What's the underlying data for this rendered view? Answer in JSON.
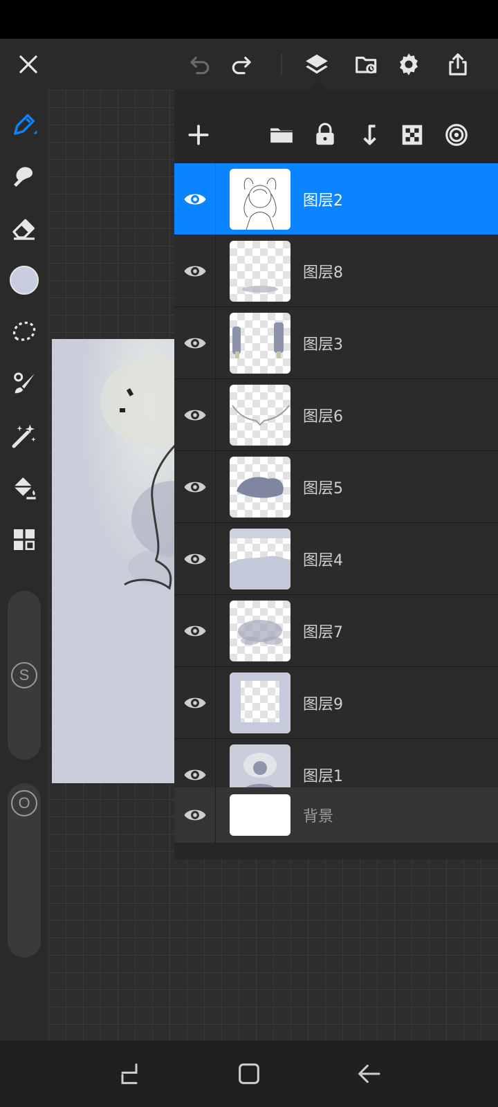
{
  "colors": {
    "accent": "#0a84ff",
    "brush_color": "#c8cee0",
    "toolbar_bg": "#2a2a2a",
    "panel_bg": "#262626",
    "icon": "#e6e6e6"
  },
  "top_toolbar": {
    "icons": [
      "close-icon",
      "undo-icon",
      "redo-icon",
      "layers-icon",
      "gallery-icon",
      "settings-icon",
      "share-icon"
    ]
  },
  "left_toolbar": {
    "tools": [
      "pen-icon",
      "smudge-icon",
      "eraser-icon",
      "color-swatch",
      "lasso-icon",
      "brush-picker-icon",
      "magic-wand-icon",
      "fill-icon",
      "grid-icon"
    ],
    "size_slider_label": "S",
    "opacity_slider_label": "O"
  },
  "layers_panel": {
    "header_icons": [
      "add-icon",
      "folder-icon",
      "lock-icon",
      "merge-down-icon",
      "transparency-icon",
      "target-icon"
    ],
    "layers": [
      {
        "name": "图层2",
        "visible": true,
        "selected": true
      },
      {
        "name": "图层8",
        "visible": true,
        "selected": false
      },
      {
        "name": "图层3",
        "visible": true,
        "selected": false
      },
      {
        "name": "图层6",
        "visible": true,
        "selected": false
      },
      {
        "name": "图层5",
        "visible": true,
        "selected": false
      },
      {
        "name": "图层4",
        "visible": true,
        "selected": false
      },
      {
        "name": "图层7",
        "visible": true,
        "selected": false
      },
      {
        "name": "图层9",
        "visible": true,
        "selected": false
      },
      {
        "name": "图层1",
        "visible": true,
        "selected": false
      }
    ],
    "background_layer": {
      "name": "背景",
      "visible": true
    }
  },
  "nav_bar": {
    "icons": [
      "recents-icon",
      "home-icon",
      "back-icon"
    ]
  }
}
